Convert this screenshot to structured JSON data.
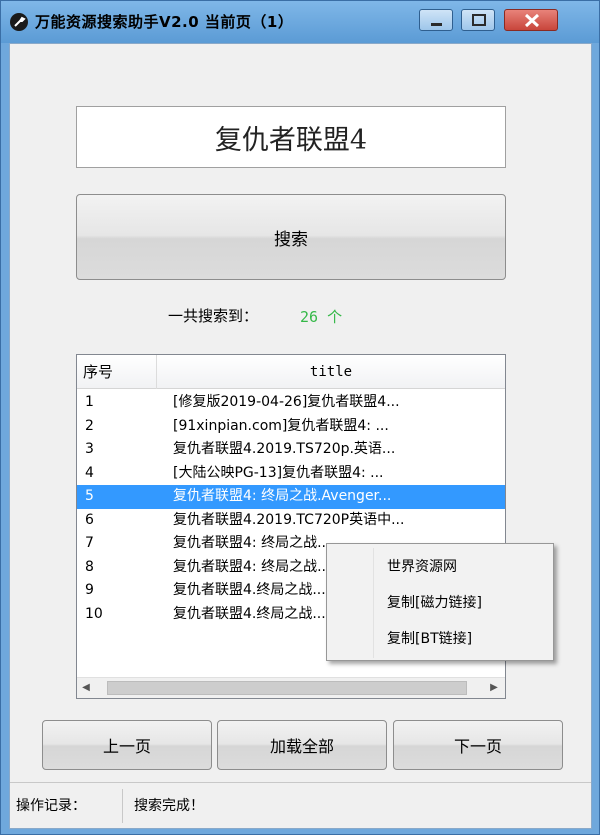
{
  "window": {
    "title": "万能资源搜索助手V2.0  当前页（1）",
    "min_icon": "minimize-icon",
    "max_icon": "maximize-icon",
    "close_icon": "close-icon",
    "app_icon": "wrench-icon"
  },
  "search": {
    "value": "复仇者联盟4",
    "button_label": "搜索"
  },
  "result_count": {
    "label": "一共搜索到：",
    "value": "26 个",
    "color": "#35b848"
  },
  "table": {
    "columns": [
      "序号",
      "title"
    ],
    "rows": [
      {
        "idx": "1",
        "title": "[修复版2019-04-26]复仇者联盟4..."
      },
      {
        "idx": "2",
        "title": "[91xinpian.com]复仇者联盟4: ..."
      },
      {
        "idx": "3",
        "title": "复仇者联盟4.2019.TS720p.英语..."
      },
      {
        "idx": "4",
        "title": "[大陆公映PG-13]复仇者联盟4: ..."
      },
      {
        "idx": "5",
        "title": "复仇者联盟4: 终局之战.Avenger..."
      },
      {
        "idx": "6",
        "title": "复仇者联盟4.2019.TC720P英语中..."
      },
      {
        "idx": "7",
        "title": "复仇者联盟4: 终局之战..."
      },
      {
        "idx": "8",
        "title": "复仇者联盟4: 终局之战..."
      },
      {
        "idx": "9",
        "title": "复仇者联盟4.终局之战..."
      },
      {
        "idx": "10",
        "title": "复仇者联盟4.终局之战..."
      }
    ],
    "selected_index": 4,
    "selection_color": "#3399ff"
  },
  "context_menu": {
    "items": [
      "世界资源网",
      "复制[磁力链接]",
      "复制[BT链接]"
    ]
  },
  "buttons": {
    "prev": "上一页",
    "load_all": "加载全部",
    "next": "下一页"
  },
  "status": {
    "label": "操作记录：",
    "text": "搜索完成！"
  }
}
